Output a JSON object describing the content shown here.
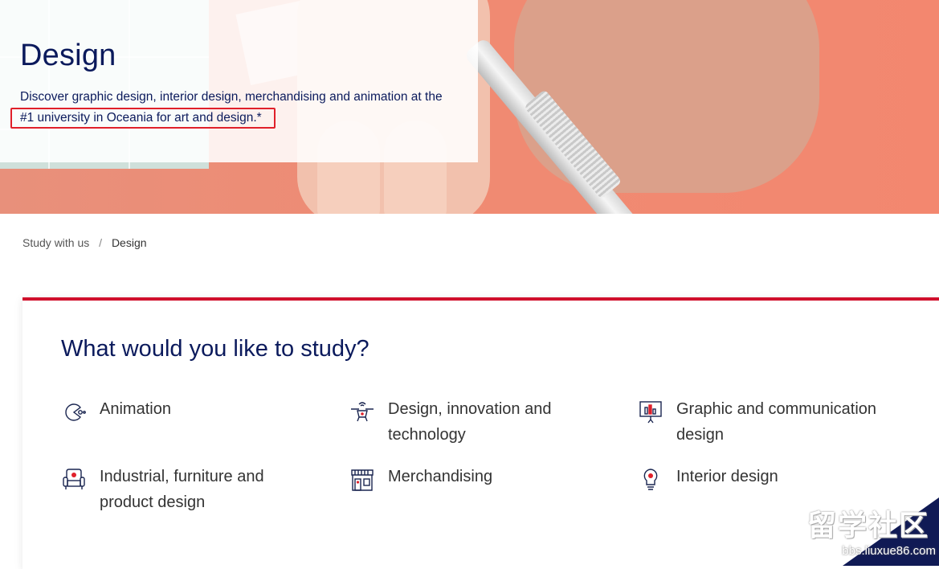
{
  "hero": {
    "title": "Design",
    "description": "Discover graphic design, interior design, merchandising and animation at the",
    "highlight": "#1 university in Oceania for art and design.*"
  },
  "breadcrumb": {
    "items": [
      {
        "label": "Study with us"
      },
      {
        "label": "Design"
      }
    ],
    "separator": "/"
  },
  "study": {
    "title": "What would you like to study?",
    "accent_color": "#d0102c",
    "items": [
      {
        "label": "Animation",
        "icon": "animation-icon"
      },
      {
        "label": "Design, innovation and technology",
        "icon": "drone-icon"
      },
      {
        "label": "Graphic and communication design",
        "icon": "presentation-board-icon"
      },
      {
        "label": "Industrial, furniture and product design",
        "icon": "armchair-icon"
      },
      {
        "label": "Merchandising",
        "icon": "storefront-icon"
      },
      {
        "label": "Interior design",
        "icon": "lightbulb-icon"
      }
    ]
  },
  "watermark": {
    "logo": "留学社区",
    "url": "bbs.liuxue86.com"
  },
  "colors": {
    "navy": "#0b1a5c",
    "red": "#e0202a"
  }
}
